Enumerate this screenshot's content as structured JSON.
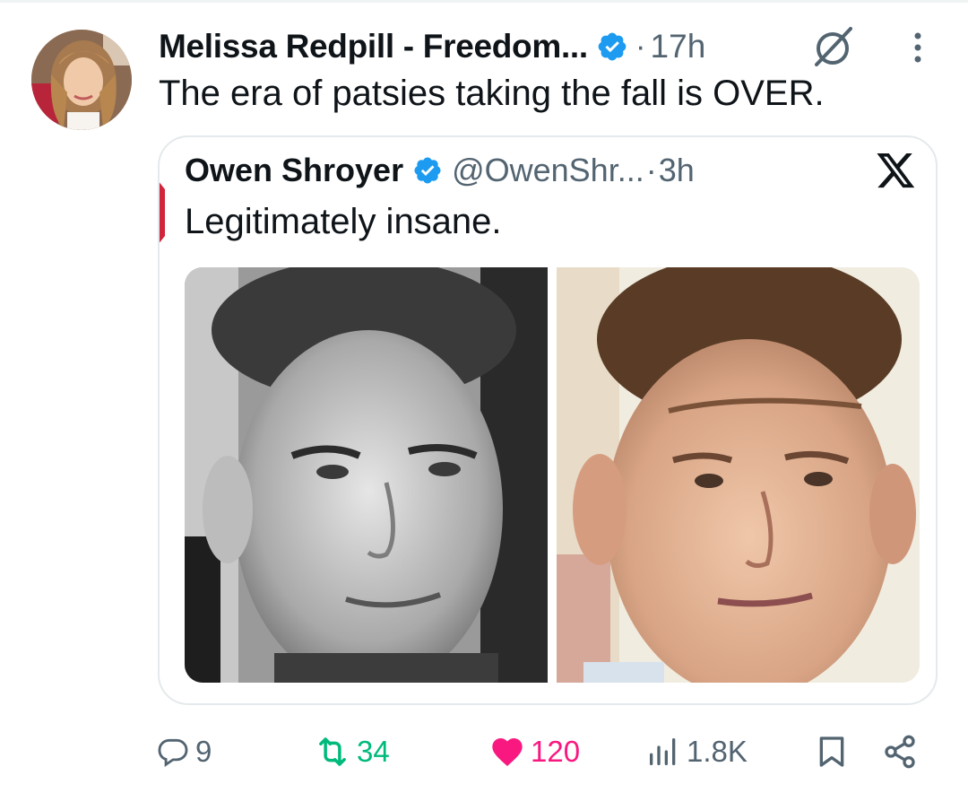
{
  "post": {
    "author_name": "Melissa Redpill - Freedom...",
    "separator": "·",
    "timestamp": "17h",
    "text": "The era of patsies taking the fall is OVER."
  },
  "quoted_post": {
    "author_name": "Owen Shroyer",
    "handle": "@OwenShr...",
    "separator": "·",
    "timestamp": "3h",
    "text": "Legitimately insane."
  },
  "actions": {
    "replies": "9",
    "reposts": "34",
    "likes": "120",
    "views": "1.8K"
  },
  "icons": {
    "verified": "verified-badge-icon",
    "grok": "grok-icon",
    "more": "more-vertical-icon",
    "x_logo": "x-logo-icon",
    "reply": "reply-icon",
    "repost": "repost-icon",
    "like": "heart-icon",
    "views": "views-chart-icon",
    "bookmark": "bookmark-icon",
    "share": "share-icon"
  },
  "colors": {
    "verified_blue": "#1d9bf0",
    "repost_green": "#00ba7c",
    "like_pink": "#f91880",
    "secondary_text": "#536471"
  }
}
